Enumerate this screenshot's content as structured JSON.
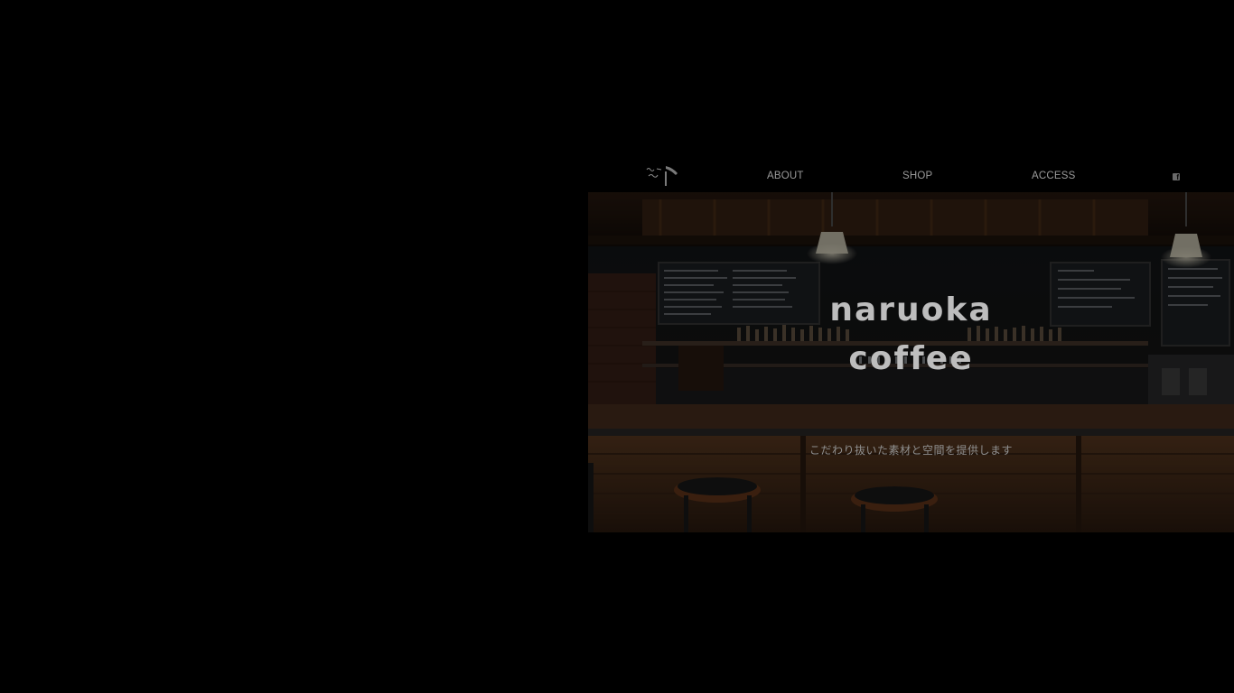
{
  "nav": {
    "items": [
      {
        "label": "ABOUT"
      },
      {
        "label": "SHOP"
      },
      {
        "label": "ACCESS"
      }
    ],
    "social": "facebook-icon"
  },
  "hero": {
    "title_line1": "naruoka",
    "title_line2": "coffee",
    "tagline": "こだわり抜いた素材と空間を提供します"
  },
  "colors": {
    "page_background": "#000000",
    "nav_text": "#9a9a9a",
    "title_text": "#bdbdbd",
    "wood": "#5a3a22"
  }
}
